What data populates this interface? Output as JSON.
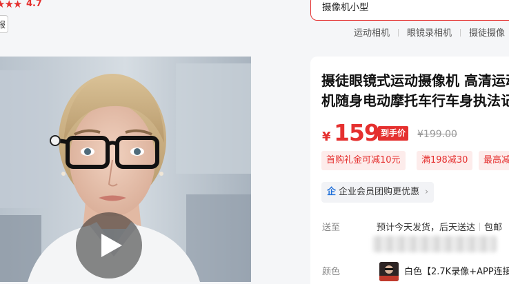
{
  "rating": {
    "stars_glyph": "★★★",
    "score": "4.7"
  },
  "header": {
    "report_button_fragment": "报"
  },
  "search": {
    "query": "摄像机小型",
    "hot_words": [
      "运动相机",
      "眼镜录相机",
      "摄徒摄像"
    ]
  },
  "product_image": {
    "play_icon": "play-icon",
    "description_shown": "video cover"
  },
  "product": {
    "title_line1": "摄徒眼镜式运动摄像机 高清运动",
    "title_line2": "机随身电动摩托车行车身执法记",
    "currency": "¥",
    "price": "159",
    "price_badge": "到手价",
    "original_price": "¥199.00",
    "coupons": [
      "首购礼金可减10元",
      "满198减30",
      "最高减"
    ],
    "member_icon": "企",
    "member_text": "企业会员团购更优惠",
    "member_chevron": "›",
    "ship_label": "送至",
    "ship_text": "预计今天发货，后天送达",
    "ship_extra": "包邮",
    "color_label": "颜色",
    "color_option": "白色【2.7K录像+APP连接"
  },
  "colors": {
    "accent": "#e5302f",
    "coupon_bg": "#fdeceb",
    "member_icon": "#1e6fd9"
  }
}
